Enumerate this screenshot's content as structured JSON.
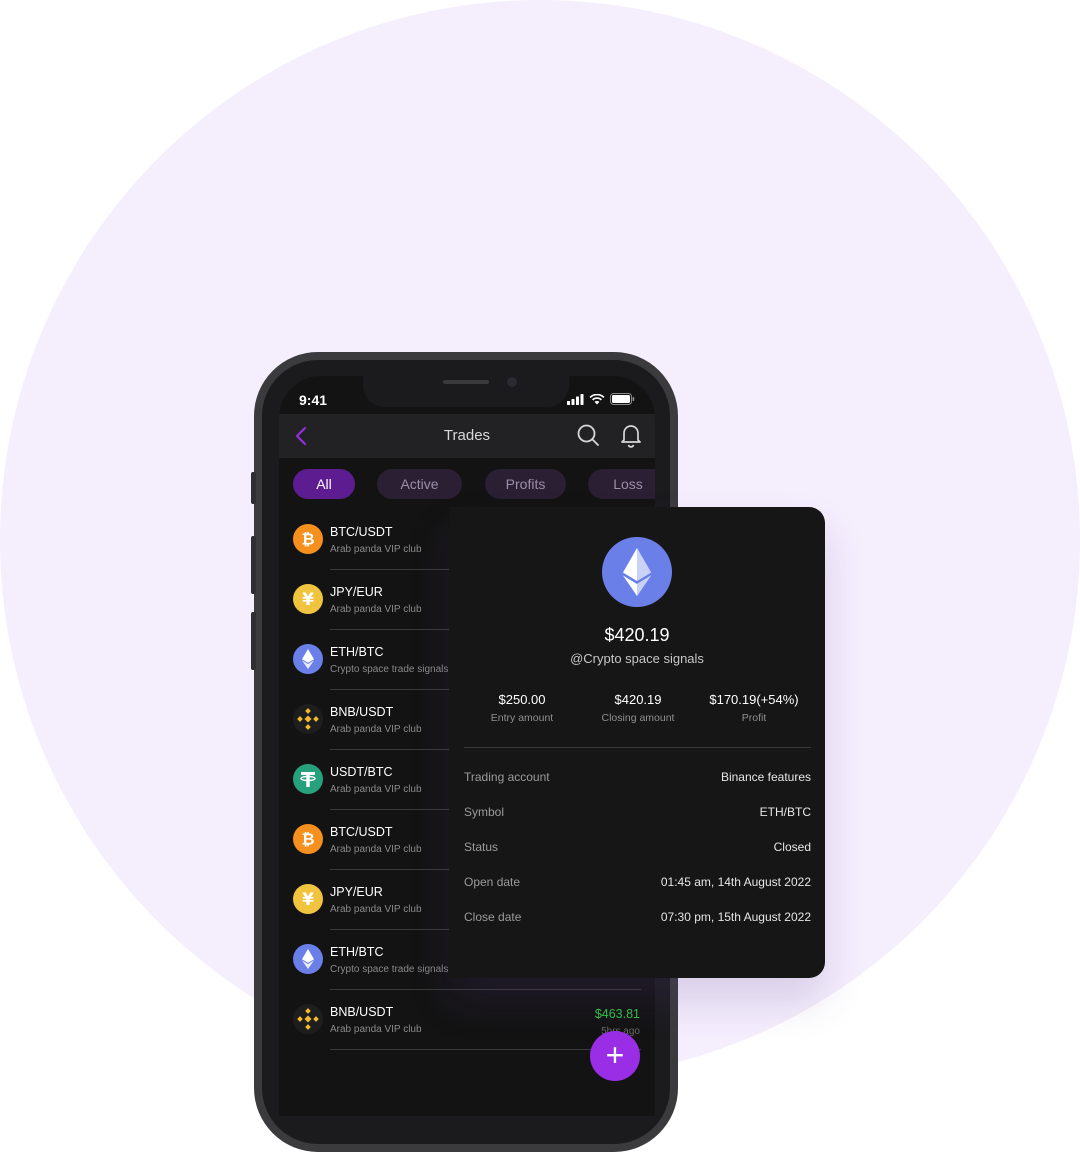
{
  "status_bar": {
    "time": "9:41"
  },
  "header": {
    "title": "Trades"
  },
  "tabs": [
    {
      "label": "All",
      "active": true
    },
    {
      "label": "Active",
      "active": false
    },
    {
      "label": "Profits",
      "active": false
    },
    {
      "label": "Loss",
      "active": false
    }
  ],
  "trades": [
    {
      "pair": "BTC/USDT",
      "group": "Arab panda VIP club",
      "coin_icon": "bitcoin-icon"
    },
    {
      "pair": "JPY/EUR",
      "group": "Arab panda VIP club",
      "coin_icon": "yen-icon"
    },
    {
      "pair": "ETH/BTC",
      "group": "Crypto space trade signals",
      "coin_icon": "ethereum-icon"
    },
    {
      "pair": "BNB/USDT",
      "group": "Arab panda VIP club",
      "coin_icon": "binance-icon"
    },
    {
      "pair": "USDT/BTC",
      "group": "Arab panda VIP club",
      "coin_icon": "tether-icon"
    },
    {
      "pair": "BTC/USDT",
      "group": "Arab panda VIP club",
      "coin_icon": "bitcoin-icon"
    },
    {
      "pair": "JPY/EUR",
      "group": "Arab panda VIP club",
      "coin_icon": "yen-icon"
    },
    {
      "pair": "ETH/BTC",
      "group": "Crypto space trade signals",
      "coin_icon": "ethereum-icon"
    },
    {
      "pair": "BNB/USDT",
      "group": "Arab panda VIP club",
      "coin_icon": "binance-icon",
      "amount": "$463.81",
      "time_ago": "5hrs ago"
    }
  ],
  "fab": {
    "symbol": "+"
  },
  "detail": {
    "price": "$420.19",
    "handle": "@Crypto space signals",
    "stats": [
      {
        "value": "$250.00",
        "label": "Entry amount"
      },
      {
        "value": "$420.19",
        "label": "Closing amount"
      },
      {
        "value": "$170.19(+54%)",
        "label": "Profit"
      }
    ],
    "rows": [
      {
        "label": "Trading account",
        "value": "Binance features"
      },
      {
        "label": "Symbol",
        "value": "ETH/BTC"
      },
      {
        "label": "Status",
        "value": "Closed"
      },
      {
        "label": "Open date",
        "value": "01:45 am, 14th August 2022"
      },
      {
        "label": "Close date",
        "value": "07:30 pm, 15th August 2022"
      }
    ]
  },
  "colors": {
    "accent": "#9a2ee6",
    "tab_active": "#5d1c8f",
    "profit": "#35c24a",
    "ethereum": "#6a7fe8",
    "bitcoin": "#f5901e",
    "yen": "#f0c43f",
    "tether": "#26a17b",
    "binance": "#f3ba2f"
  }
}
